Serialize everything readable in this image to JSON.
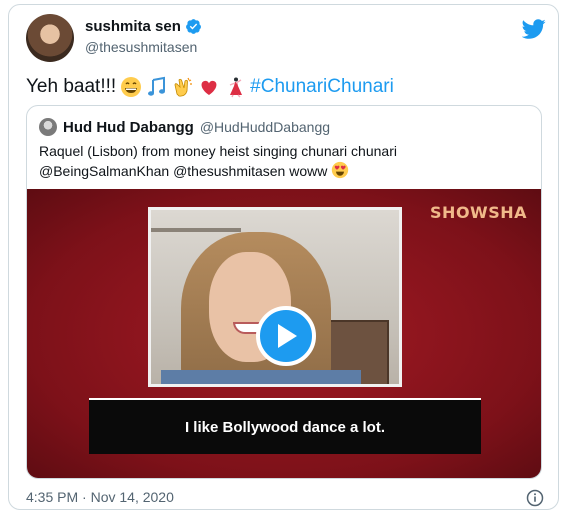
{
  "tweet": {
    "display_name": "sushmita sen",
    "handle": "@thesushmitasen",
    "text": "Yeh baat!!!",
    "emojis": [
      "grinning-face",
      "musical-notes",
      "clapping-hands",
      "red-heart",
      "dancer"
    ],
    "hashtag": "#ChunariChunari",
    "timestamp": "4:35 PM · Nov 14, 2020",
    "verified": true
  },
  "quoted": {
    "display_name": "Hud Hud Dabangg",
    "handle": "@HudHuddDabangg",
    "text": "Raquel (Lisbon) from money heist singing chunari chunari @BeingSalmanKhan @thesushmitasen woww",
    "emoji": "heart-eyes"
  },
  "media": {
    "brand": "SHOWSHA",
    "subtitle": "I like Bollywood dance a lot."
  },
  "icons": {
    "platform": "twitter-bird-icon",
    "info": "info-icon"
  },
  "colors": {
    "accent": "#1d9bf0",
    "media_bg": "#8e141d",
    "muted_text": "#536471"
  }
}
